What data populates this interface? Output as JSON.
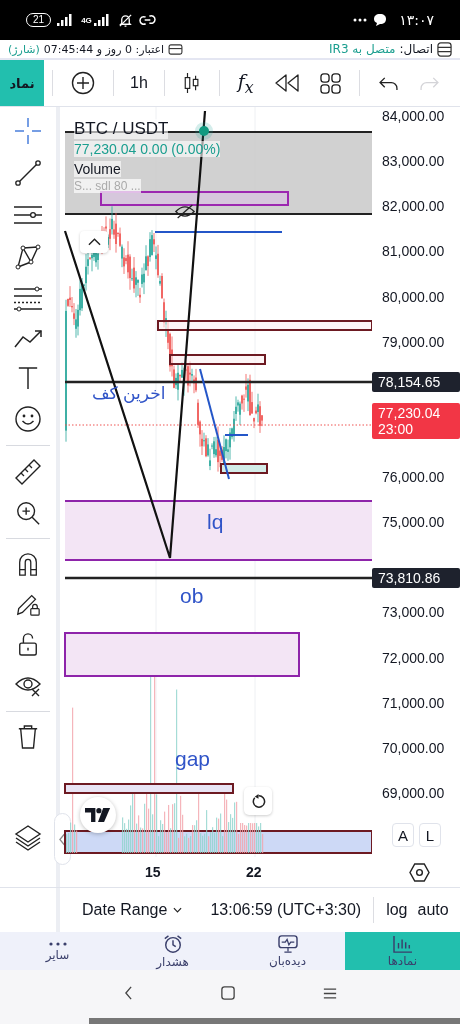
{
  "status_bar": {
    "battery": "21",
    "network": "4G",
    "time": "۱۳:۰۷"
  },
  "info_bar": {
    "connection_label": "اتصال:",
    "connection_value": "متصل به IR3",
    "credit": "اعتبار: 0 روز و 07:45:44",
    "charge": "(شارژ)"
  },
  "toolbar": {
    "symbol_button": "نماد",
    "interval": "1h",
    "indicators": "f$_{x}$",
    "redo_disabled": true
  },
  "chart": {
    "legend": {
      "symbol": "BTC / USDT",
      "quote": "77,230.04  0.00 (0.00%)",
      "volume": "Volume",
      "study": "S... sdl 80 ..."
    },
    "annotations": [
      {
        "text": "اخرین کف",
        "kind": "rtl"
      },
      {
        "text": "lq",
        "kind": "ltr"
      },
      {
        "text": "ob",
        "kind": "ltr"
      },
      {
        "text": "gap",
        "kind": "ltr"
      }
    ],
    "price_axis": [
      "84,000.00",
      "83,000.00",
      "82,000.00",
      "81,000.00",
      "80,000.00",
      "79,000.00",
      "76,000.00",
      "75,000.00",
      "73,000.00",
      "72,000.00",
      "71,000.00",
      "70,000.00",
      "69,000.00"
    ],
    "price_badges": [
      {
        "kind": "line",
        "text": "78,154.65"
      },
      {
        "kind": "last",
        "text": "77,230.04",
        "countdown": "23:00"
      },
      {
        "kind": "line",
        "text": "73,810.86"
      }
    ],
    "time_axis": [
      "15",
      "22"
    ],
    "scale_buttons": [
      "A",
      "L"
    ]
  },
  "bottom_bar": {
    "date_range": "Date Range",
    "clock": "13:06:59 (UTC+3:30)",
    "log": "log",
    "auto": "auto"
  },
  "nav_tabs": [
    {
      "label": "نمادها",
      "selected": true
    },
    {
      "label": "دیده‌بان",
      "selected": false
    },
    {
      "label": "هشدار",
      "selected": false
    },
    {
      "label": "سایر",
      "selected": false
    }
  ]
}
